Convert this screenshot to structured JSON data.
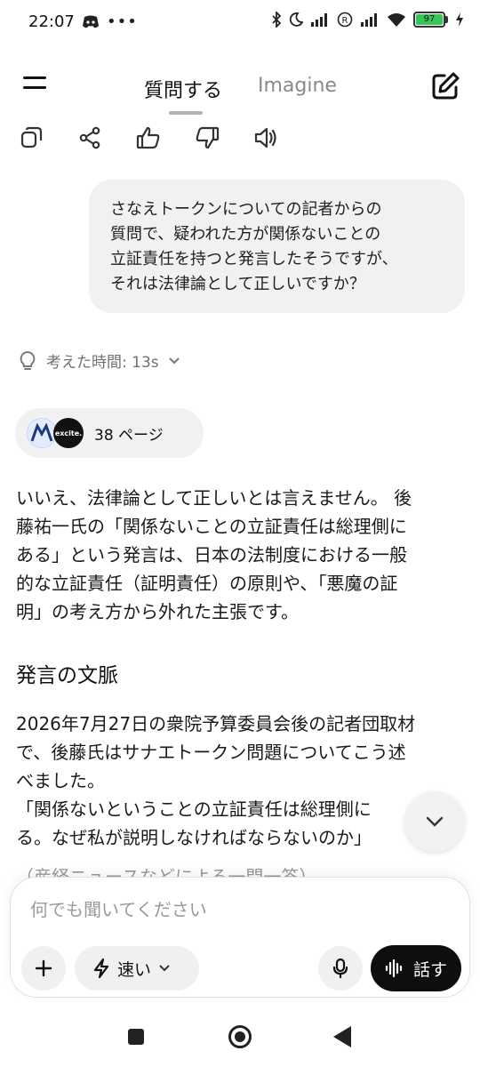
{
  "status_bar": {
    "time": "22:07",
    "left_icons": [
      "discord-icon",
      "more-icon"
    ],
    "right_icons": [
      "bluetooth-icon",
      "moon-icon",
      "signal-icon",
      "r-icon",
      "signal-icon",
      "wifi-icon"
    ],
    "battery": "97"
  },
  "header": {
    "tab_ask": "質問する",
    "tab_imagine": "Imagine"
  },
  "actions": [
    "copy-icon",
    "share-icon",
    "thumbs-up-icon",
    "thumbs-down-icon",
    "speaker-icon"
  ],
  "user_message": {
    "lines": [
      "さなえトークンについての記者からの",
      "質問で、疑われた方が関係ないことの",
      "立証責任を持つと発言したそうですが、",
      "それは法律論として正しいですか？"
    ]
  },
  "thought": {
    "label": "考えた時間: 13s"
  },
  "sources": {
    "label": "38 ページ",
    "source2_text": "excite."
  },
  "answer": {
    "lines": [
      "いいえ、法律論として正しいとは言えません。 後",
      "藤祐一氏の「関係ないことの立証責任は総理側に",
      "ある」という発言は、日本の法制度における一般",
      "的な立証責任（証明責任）の原則や、「悪魔の証",
      "明」の考え方から外れた主張です。"
    ],
    "section_title": "発言の文脈",
    "body_lines": [
      "2026年7月27日の衆院予算委員会後の記者団取材",
      "で、後藤氏はサナエトークン問題についてこう述",
      "べました。",
      "「関係ないということの立証責任は総理側に",
      "る。なぜ私が説明しなければならないのか」"
    ],
    "faded_line": "（産経ニュースなどによる一問一答）"
  },
  "composer": {
    "placeholder": "何でも聞いてください",
    "mode_label": "速い",
    "talk_label": "話す"
  },
  "colors": {
    "bubble": "#f1f1f1",
    "battery": "#39c45a",
    "talk_button": "#0e0e0e"
  }
}
